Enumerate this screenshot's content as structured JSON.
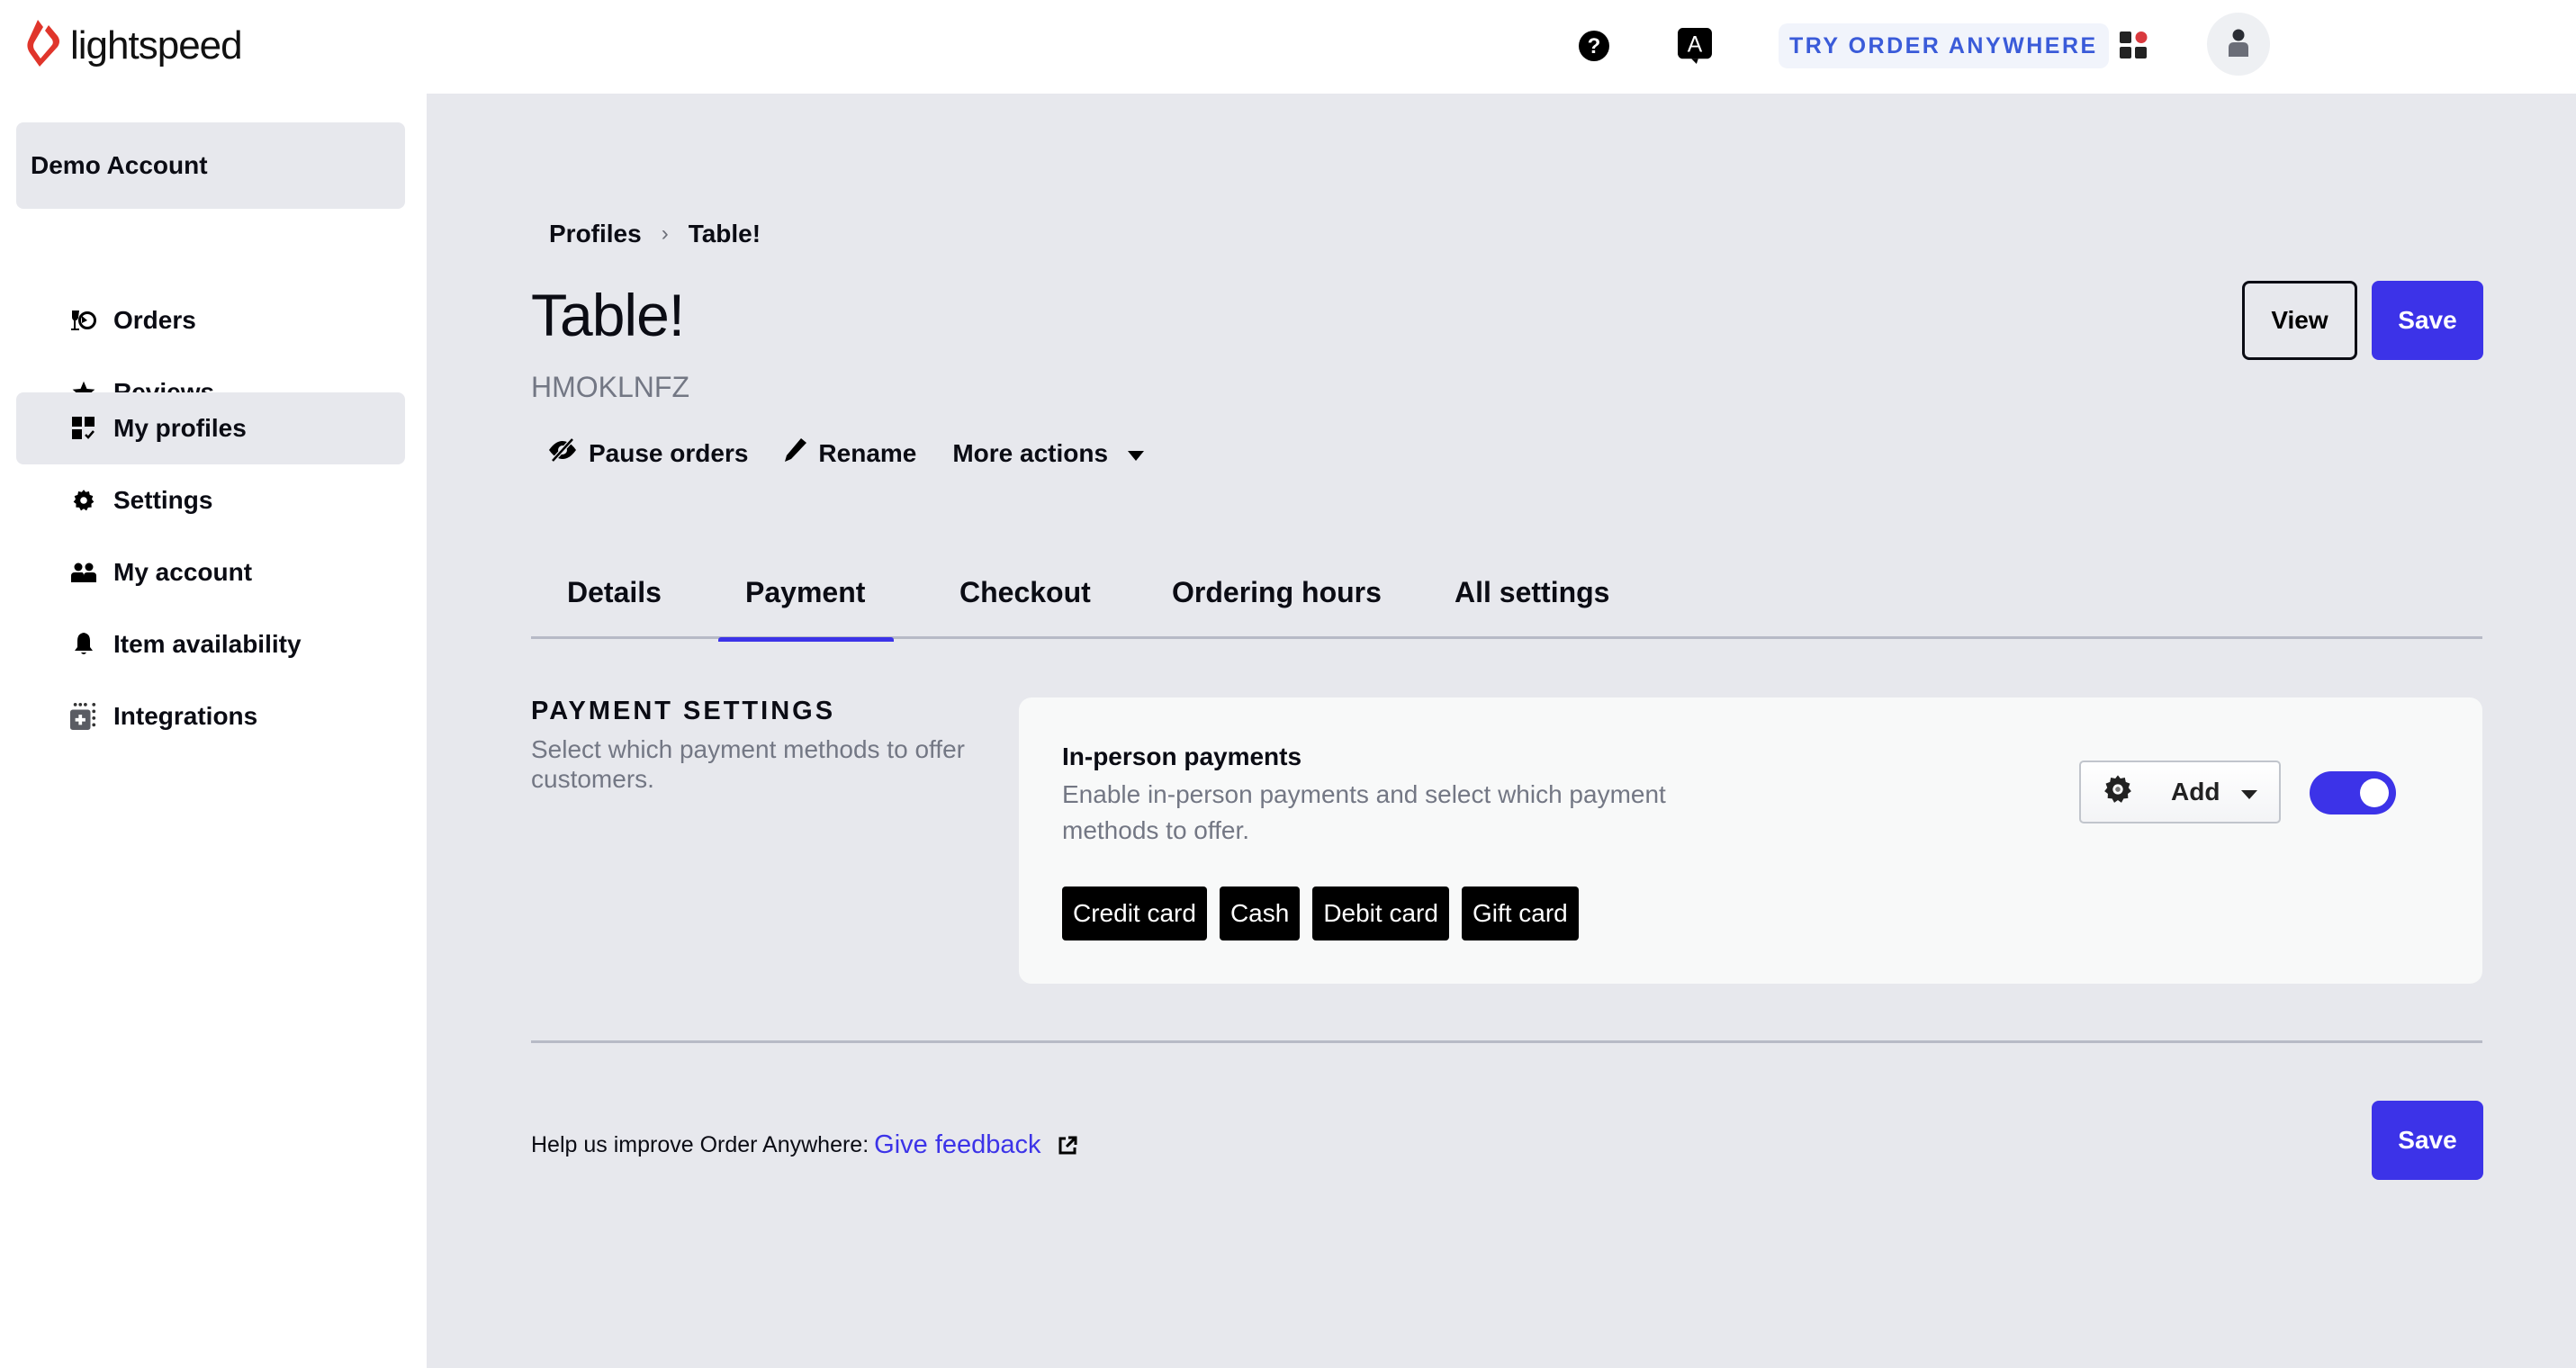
{
  "header": {
    "brand": "lightspeed",
    "try_button": "TRY ORDER ANYWHERE",
    "help_icon": "help-circle-icon",
    "translate_icon": "language-icon",
    "apps_icon": "apps-grid-icon",
    "profile_icon": "user-icon"
  },
  "sidebar": {
    "account": "Demo Account",
    "items": [
      {
        "label": "Orders",
        "icon": "orders-icon",
        "active": false
      },
      {
        "label": "Reviews",
        "icon": "star-icon",
        "active": false
      },
      {
        "label": "My profiles",
        "icon": "profiles-icon",
        "active": true
      },
      {
        "label": "Settings",
        "icon": "gear-icon",
        "active": false
      },
      {
        "label": "My account",
        "icon": "users-icon",
        "active": false
      },
      {
        "label": "Item availability",
        "icon": "bell-icon",
        "active": false
      },
      {
        "label": "Integrations",
        "icon": "integrations-icon",
        "active": false
      }
    ]
  },
  "page": {
    "breadcrumb": [
      "Profiles",
      "Table!"
    ],
    "title": "Table!",
    "code": "HMOKLNFZ",
    "actions": {
      "pause": "Pause orders",
      "rename": "Rename",
      "more": "More actions"
    },
    "view_label": "View",
    "save_label": "Save",
    "tabs": [
      {
        "label": "Details",
        "active": false
      },
      {
        "label": "Payment",
        "active": true
      },
      {
        "label": "Checkout",
        "active": false
      },
      {
        "label": "Ordering hours",
        "active": false
      },
      {
        "label": "All settings",
        "active": false
      }
    ]
  },
  "payment_settings": {
    "title": "PAYMENT SETTINGS",
    "description": "Select which payment methods to offer customers.",
    "in_person": {
      "title": "In-person payments",
      "description": "Enable in-person payments and select which payment methods to offer.",
      "methods": [
        "Credit card",
        "Cash",
        "Debit card",
        "Gift card"
      ],
      "add_label": "Add",
      "enabled": true
    }
  },
  "footer": {
    "feedback_text": "Help us improve Order Anywhere:",
    "feedback_link": "Give feedback",
    "save_label": "Save"
  },
  "colors": {
    "accent": "#3c33e8",
    "brand": "#e0352b",
    "background": "#e7e8ed",
    "try_text": "#3a5bd9"
  }
}
